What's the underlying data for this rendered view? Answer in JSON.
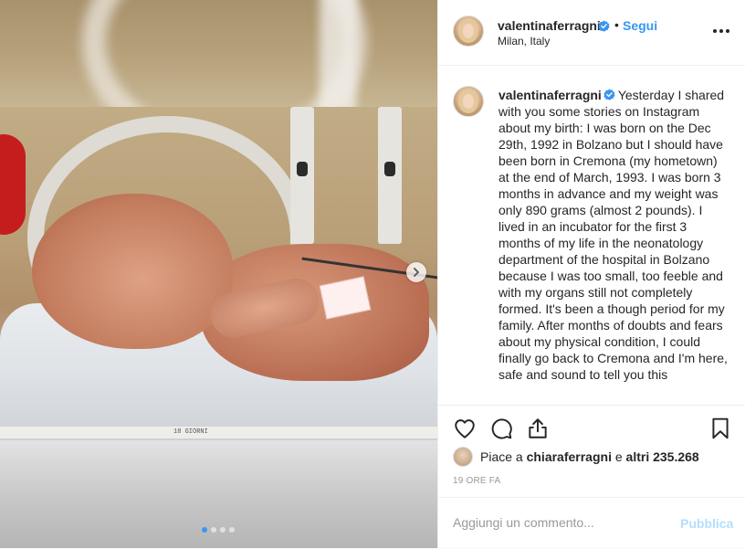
{
  "post": {
    "username": "valentinaferragni",
    "follow_label": "Segui",
    "separator": "•",
    "location": "Milan, Italy",
    "caption_username": "valentinaferragni",
    "caption_text": "Yesterday I shared with you some stories on Instagram about my birth: I was born on the Dec 29th, 1992 in Bolzano but I should have been born in Cremona (my hometown) at the end of March, 1993. I was born 3 months in advance and my weight was only 890 grams (almost 2 pounds). I lived in an incubator for the first 3 months of my life in the neonatology department of the hospital in Bolzano because I was too small, too feeble and with my organs still not completely formed. It's been a though period for my family. After months of doubts and fears about my physical condition, I could finally go back to Cremona and I'm here, safe and sound to tell you this",
    "likes_prefix": "Piace a",
    "likes_user": "chiaraferragni",
    "likes_middle": "e",
    "likes_rest": "altri 235.268",
    "timestamp": "19 ORE FA"
  },
  "media": {
    "photo_strip_text": "18 GIORNI",
    "carousel_count": 4,
    "carousel_active_index": 0
  },
  "comment": {
    "placeholder": "Aggiungi un commento...",
    "publish_label": "Pubblica"
  },
  "colors": {
    "link_blue": "#3897f0",
    "publish_disabled": "#b2dffc",
    "text": "#262626",
    "muted": "#999999",
    "border": "#efefef"
  },
  "icons": [
    "verified-badge-icon",
    "more-options-icon",
    "heart-icon",
    "comment-icon",
    "share-icon",
    "bookmark-icon",
    "chevron-right-icon"
  ]
}
